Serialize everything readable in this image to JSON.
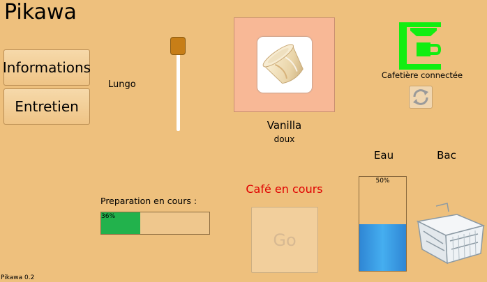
{
  "app": {
    "title": "Pikawa",
    "version": "Pikawa 0.2"
  },
  "sidebar": {
    "items": [
      {
        "label": "Informations"
      },
      {
        "label": "Entretien"
      }
    ]
  },
  "coffee_size": {
    "label": "Lungo",
    "level": 1.0
  },
  "capsule": {
    "name": "Vanilla",
    "strength": "doux"
  },
  "machine": {
    "status": "Cafetière connectée",
    "status_color": "#11ee11",
    "refresh_icon": "refresh-icon"
  },
  "water": {
    "label": "Eau",
    "level_percent": 50,
    "level_text": "50%"
  },
  "bac": {
    "label": "Bac",
    "icon": "drip-tray-icon"
  },
  "preparation": {
    "label": "Preparation en cours :",
    "progress_percent": 36,
    "progress_text": "36%"
  },
  "cafe": {
    "status": "Café en cours",
    "status_color": "#e00000"
  },
  "go_button": {
    "label": "Go",
    "enabled": false
  },
  "colors": {
    "background": "#eec07d",
    "accent": "#c77e17",
    "capsule_panel": "#f8b896",
    "progress_fill": "#22b24c",
    "water": "#3a9fe6"
  }
}
